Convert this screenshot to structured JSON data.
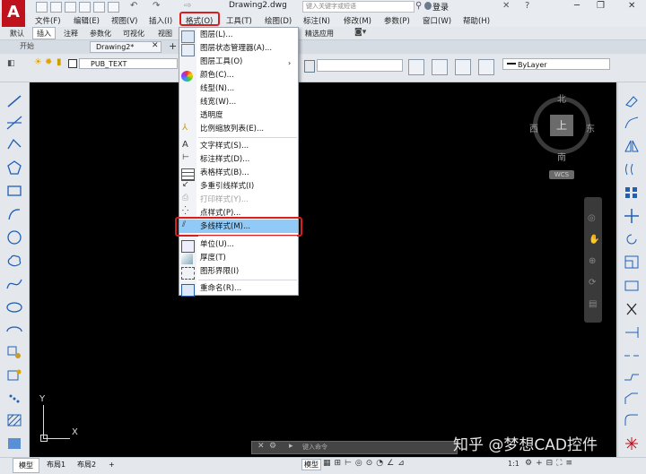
{
  "titlebar": {
    "doc_title": "Drawing2.dwg",
    "search_placeholder": "键入关键字或短语",
    "login": "登录"
  },
  "menubar": [
    "文件(F)",
    "编辑(E)",
    "视图(V)",
    "插入(I)",
    "格式(O)",
    "工具(T)",
    "绘图(D)",
    "标注(N)",
    "修改(M)",
    "参数(P)",
    "窗口(W)",
    "帮助(H)"
  ],
  "ribbon_tabs": [
    "默认",
    "插入",
    "注释",
    "参数化",
    "可视化",
    "视图",
    "精选应用"
  ],
  "file_tabs": {
    "start": "开始",
    "drawing": "Drawing2*"
  },
  "toolbar": {
    "layer": "PUB_TEXT",
    "lineweight": "ByLayer"
  },
  "format_menu": {
    "items": [
      "图层(L)...",
      "图层状态管理器(A)...",
      "图层工具(O)",
      "颜色(C)...",
      "线型(N)...",
      "线宽(W)...",
      "透明度",
      "比例缩放列表(E)...",
      "文字样式(S)...",
      "标注样式(D)...",
      "表格样式(B)...",
      "多重引线样式(I)",
      "打印样式(Y)...",
      "点样式(P)...",
      "多线样式(M)...",
      "单位(U)...",
      "厚度(T)",
      "图形界限(I)",
      "重命名(R)..."
    ],
    "highlighted": "多线样式(M)..."
  },
  "viewcube": {
    "top": "上",
    "north": "北",
    "south": "南",
    "east": "东",
    "west": "西",
    "wcs": "WCS"
  },
  "ucs": {
    "x": "X",
    "y": "Y"
  },
  "command_placeholder": "键入命令",
  "layout_tabs": [
    "模型",
    "布局1",
    "布局2",
    "+"
  ],
  "status": {
    "model": "模型",
    "scale": "1:1"
  },
  "watermark": "知乎 @梦想CAD控件",
  "colors": {
    "highlight": "#91c9f7",
    "annotation_red": "#d81e1e",
    "canvas": "#000000"
  }
}
